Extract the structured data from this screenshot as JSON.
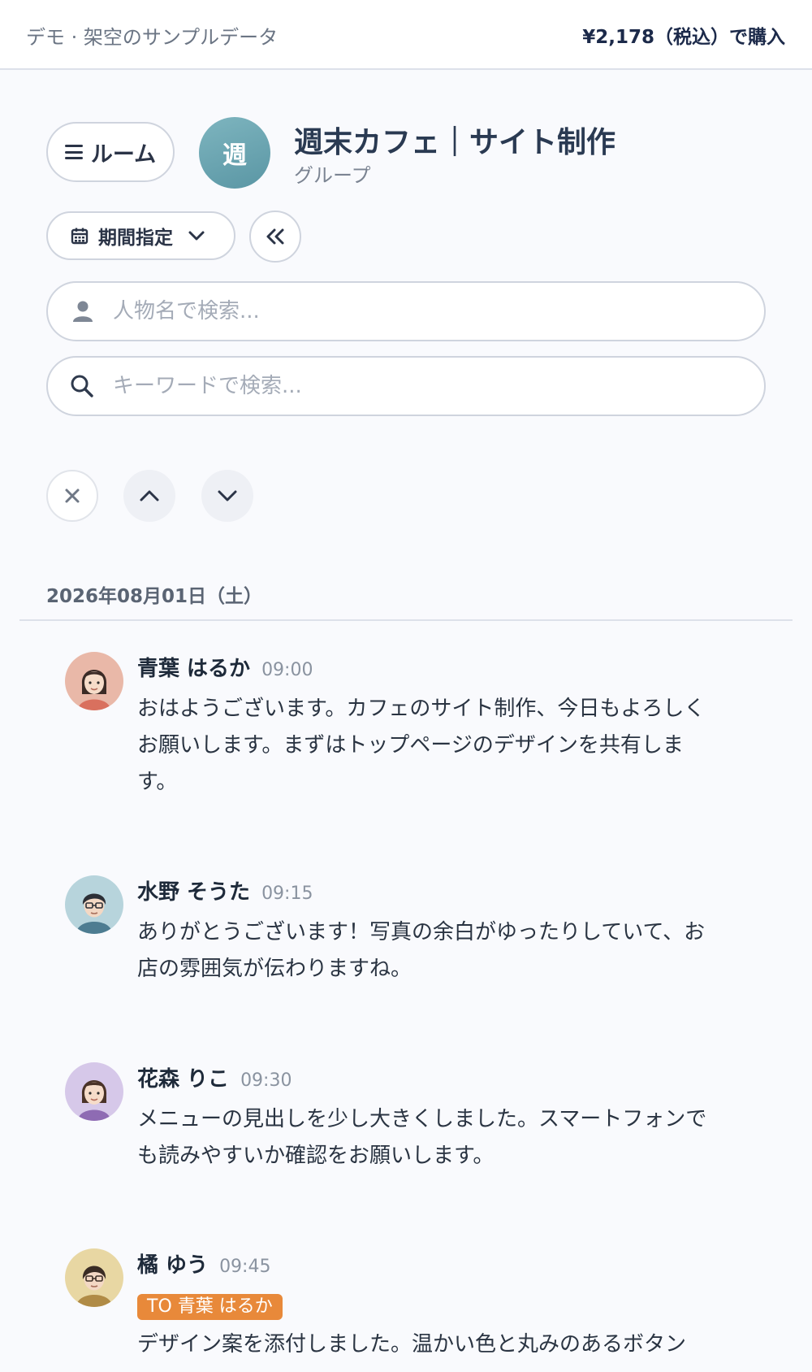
{
  "topbar": {
    "demo_label": "デモ · 架空のサンプルデータ",
    "buy_label": "¥2,178（税込）で購入"
  },
  "room": {
    "menu_label": "ルーム",
    "avatar_char": "週",
    "title": "週末カフェ｜サイト制作",
    "subtitle": "グループ",
    "avatar_color": "#6aa7b3"
  },
  "filters": {
    "period_label": "期間指定",
    "person_placeholder": "人物名で検索...",
    "keyword_placeholder": "キーワードで検索..."
  },
  "date_header": "2026年08月01日（土）",
  "messages": [
    {
      "name": "青葉 はるか",
      "time": "09:00",
      "text": "おはようございます。カフェのサイト制作、今日もよろしくお願いします。まずはトップページのデザインを共有します。",
      "avatar_bg": "#e9b8a8",
      "shirt_color": "#d9705e"
    },
    {
      "name": "水野 そうた",
      "time": "09:15",
      "text": "ありがとうございます！写真の余白がゆったりしていて、お店の雰囲気が伝わりますね。",
      "avatar_bg": "#b7d4dc",
      "shirt_color": "#4d7c91"
    },
    {
      "name": "花森 りこ",
      "time": "09:30",
      "text": "メニューの見出しを少し大きくしました。スマートフォンでも読みやすいか確認をお願いします。",
      "avatar_bg": "#d6c8e9",
      "shirt_color": "#8e6bb3"
    },
    {
      "name": "橘 ゆう",
      "time": "09:45",
      "to": "TO 青葉 はるか",
      "text": "デザイン案を添付しました。温かい色と丸みのあるボタン",
      "avatar_bg": "#e8d7a3",
      "shirt_color": "#b08b46"
    }
  ],
  "colors": {
    "accent_orange": "#e8893a",
    "text_dark": "#1e2a3a",
    "border": "#cfd4de"
  }
}
